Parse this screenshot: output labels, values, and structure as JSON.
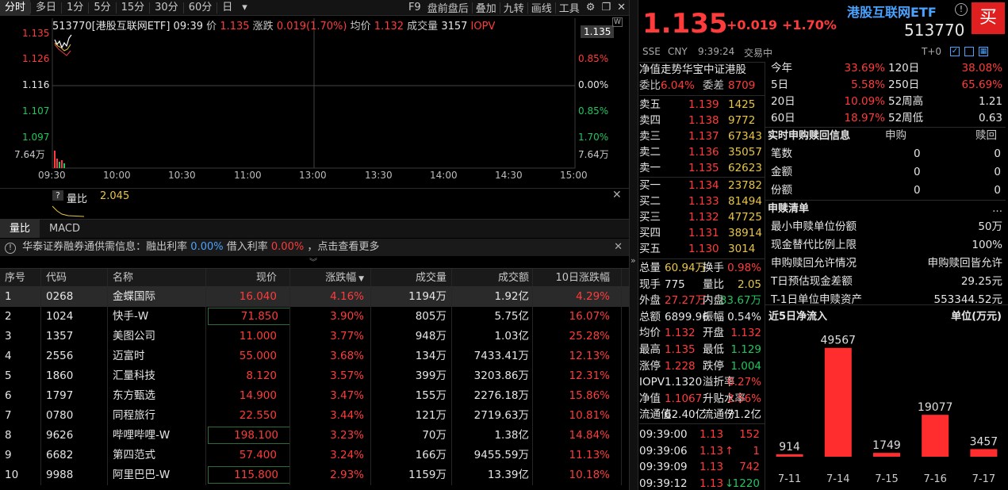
{
  "toolbar": {
    "tabs": [
      "分时",
      "多日",
      "1分",
      "5分",
      "15分",
      "30分",
      "60分",
      "日"
    ],
    "more": "▾",
    "tools": [
      "F9",
      "盘前盘后",
      "叠加",
      "九转",
      "画线",
      "工具"
    ]
  },
  "chart": {
    "info": {
      "code_name": "513770[港股互联网ETF]",
      "time": "09:39",
      "price_label": "价",
      "price": "1.135",
      "change_label": "涨跌",
      "change": "0.019(1.70%)",
      "avg_label": "均价",
      "avg": "1.132",
      "vol_label": "成交量",
      "vol": "3157",
      "iopv": "IOPV"
    },
    "y_left": [
      "1.135",
      "1.126",
      "1.116",
      "1.107",
      "1.097",
      "7.64万"
    ],
    "y_right": [
      "1.135",
      "0.85%",
      "0.00%",
      "0.85%",
      "1.70%",
      "7.64万"
    ],
    "x_ticks": [
      "09:30",
      "10:00",
      "10:30",
      "11:00",
      "13:00",
      "13:30",
      "14:00",
      "14:30",
      "15:00"
    ]
  },
  "ratio": {
    "label": "量比",
    "value": "2.045",
    "help": "?"
  },
  "subtabs": [
    "量比",
    "MACD"
  ],
  "notice": {
    "prefix": "华泰证券融券通供需信息：融出利率",
    "rate1": "0.00%",
    "mid": "借入利率",
    "rate2": "0.00%",
    "suffix": "，点击查看更多"
  },
  "table": {
    "headers": [
      "序号",
      "代码",
      "名称",
      "现价",
      "涨跌幅",
      "成交量",
      "成交额",
      "10日涨跌幅"
    ],
    "rows": [
      [
        "1",
        "0268",
        "金蝶国际",
        "16.040",
        "4.16%",
        "1194万",
        "1.92亿",
        "4.29%"
      ],
      [
        "2",
        "1024",
        "快手-W",
        "71.850",
        "3.90%",
        "805万",
        "5.75亿",
        "16.07%"
      ],
      [
        "3",
        "1357",
        "美图公司",
        "11.000",
        "3.77%",
        "948万",
        "1.03亿",
        "25.28%"
      ],
      [
        "4",
        "2556",
        "迈富时",
        "55.000",
        "3.68%",
        "134万",
        "7433.41万",
        "12.13%"
      ],
      [
        "5",
        "1860",
        "汇量科技",
        "8.120",
        "3.57%",
        "399万",
        "3203.86万",
        "12.31%"
      ],
      [
        "6",
        "1797",
        "东方甄选",
        "14.900",
        "3.47%",
        "155万",
        "2276.18万",
        "15.86%"
      ],
      [
        "7",
        "0780",
        "同程旅行",
        "22.550",
        "3.44%",
        "121万",
        "2719.63万",
        "10.81%"
      ],
      [
        "8",
        "9626",
        "哔哩哔哩-W",
        "198.100",
        "3.23%",
        "70万",
        "1.38亿",
        "14.84%"
      ],
      [
        "9",
        "6682",
        "第四范式",
        "57.400",
        "3.24%",
        "166万",
        "9455.59万",
        "11.13%"
      ],
      [
        "10",
        "9988",
        "阿里巴巴-W",
        "115.800",
        "2.93%",
        "1159万",
        "13.39亿",
        "10.18%"
      ]
    ]
  },
  "quote": {
    "price": "1.135",
    "change": "+0.019",
    "change_pct": "+1.70%",
    "name": "港股互联网ETF",
    "code": "513770",
    "buy": "买",
    "exchange": "SSE",
    "currency": "CNY",
    "time": "9:39:24",
    "status": "交易中",
    "t0": "T+0"
  },
  "orderbook": {
    "nav_label": "净值走势",
    "index_name": "华宝中证港股",
    "weibi_label": "委比",
    "weibi": "6.04%",
    "weicha_label": "委差",
    "weicha": "8709",
    "asks": [
      {
        "label": "卖五",
        "price": "1.139",
        "vol": "1425"
      },
      {
        "label": "卖四",
        "price": "1.138",
        "vol": "9772"
      },
      {
        "label": "卖三",
        "price": "1.137",
        "vol": "67343"
      },
      {
        "label": "卖二",
        "price": "1.136",
        "vol": "35057"
      },
      {
        "label": "卖一",
        "price": "1.135",
        "vol": "62623"
      }
    ],
    "bids": [
      {
        "label": "买一",
        "price": "1.134",
        "vol": "23782"
      },
      {
        "label": "买二",
        "price": "1.133",
        "vol": "81494"
      },
      {
        "label": "买三",
        "price": "1.132",
        "vol": "47725"
      },
      {
        "label": "买四",
        "price": "1.131",
        "vol": "38914"
      },
      {
        "label": "买五",
        "price": "1.130",
        "vol": "3014"
      }
    ],
    "stats": [
      {
        "l1": "总量",
        "v1": "60.94万",
        "l2": "换手",
        "v2": "0.98%"
      },
      {
        "l1": "现手",
        "v1": "775",
        "l2": "量比",
        "v2": "2.05"
      },
      {
        "l1": "外盘",
        "v1": "27.27万",
        "l2": "内盘",
        "v2": "33.67万"
      },
      {
        "l1": "总额",
        "v1": "6899.96",
        "l2": "振幅",
        "v2": "0.54%"
      },
      {
        "l1": "均价",
        "v1": "1.132",
        "l2": "开盘",
        "v2": "1.132"
      },
      {
        "l1": "最高",
        "v1": "1.135",
        "l2": "最低",
        "v2": "1.129"
      },
      {
        "l1": "涨停",
        "v1": "1.228",
        "l2": "跌停",
        "v2": "1.004"
      },
      {
        "l1": "IOPV",
        "v1": "1.1320",
        "l2": "溢折率",
        "v2": "0.27%"
      },
      {
        "l1": "净值",
        "v1": "1.1067",
        "l2": "升贴水率",
        "v2": "2.56%"
      },
      {
        "l1": "流通值",
        "v1": "62.40亿",
        "l2": "流通份",
        "v2": "71.2亿"
      }
    ],
    "ticks": [
      {
        "time": "09:39:00",
        "price": "1.13",
        "vol": "152",
        "dir": ""
      },
      {
        "time": "09:39:06",
        "price": "1.13",
        "vol": "1",
        "dir": "↑"
      },
      {
        "time": "09:39:09",
        "price": "1.13",
        "vol": "742",
        "dir": ""
      },
      {
        "time": "09:39:12",
        "price": "1.13",
        "vol": "1220",
        "dir": "↓"
      }
    ]
  },
  "perf": {
    "rows": [
      {
        "l1": "今年",
        "v1": "33.69%",
        "l2": "120日",
        "v2": "38.08%"
      },
      {
        "l1": "5日",
        "v1": "5.58%",
        "l2": "250日",
        "v2": "65.69%"
      },
      {
        "l1": "20日",
        "v1": "10.09%",
        "l2": "52周高",
        "v2": "1.21"
      },
      {
        "l1": "60日",
        "v1": "18.97%",
        "l2": "52周低",
        "v2": "0.63"
      }
    ]
  },
  "realtime": {
    "title": "实时申购赎回信息",
    "col1": "申购",
    "col2": "赎回",
    "rows": [
      {
        "label": "笔数",
        "a": "0",
        "b": "0"
      },
      {
        "label": "金额",
        "a": "0",
        "b": "0"
      },
      {
        "label": "份额",
        "a": "0",
        "b": "0"
      }
    ]
  },
  "list": {
    "title": "申赎清单",
    "more": "...",
    "rows": [
      {
        "label": "最小申赎单位份额",
        "value": "50万"
      },
      {
        "label": "现金替代比例上限",
        "value": "100%"
      },
      {
        "label": "申购赎回允许情况",
        "value": "申购赎回皆允许"
      },
      {
        "label": "T日预估现金差额",
        "value": "29.25元"
      },
      {
        "label": "T-1日单位申赎资产",
        "value": "553344.52元"
      }
    ]
  },
  "chart_data": {
    "type": "bar",
    "title": "近5日净流入",
    "unit_label": "单位(万元)",
    "categories": [
      "7-11",
      "7-14",
      "7-15",
      "7-16",
      "7-17"
    ],
    "values": [
      914,
      49567,
      1749,
      19077,
      3457
    ],
    "ylim": [
      0,
      52000
    ],
    "color": "#ff2d2d"
  }
}
